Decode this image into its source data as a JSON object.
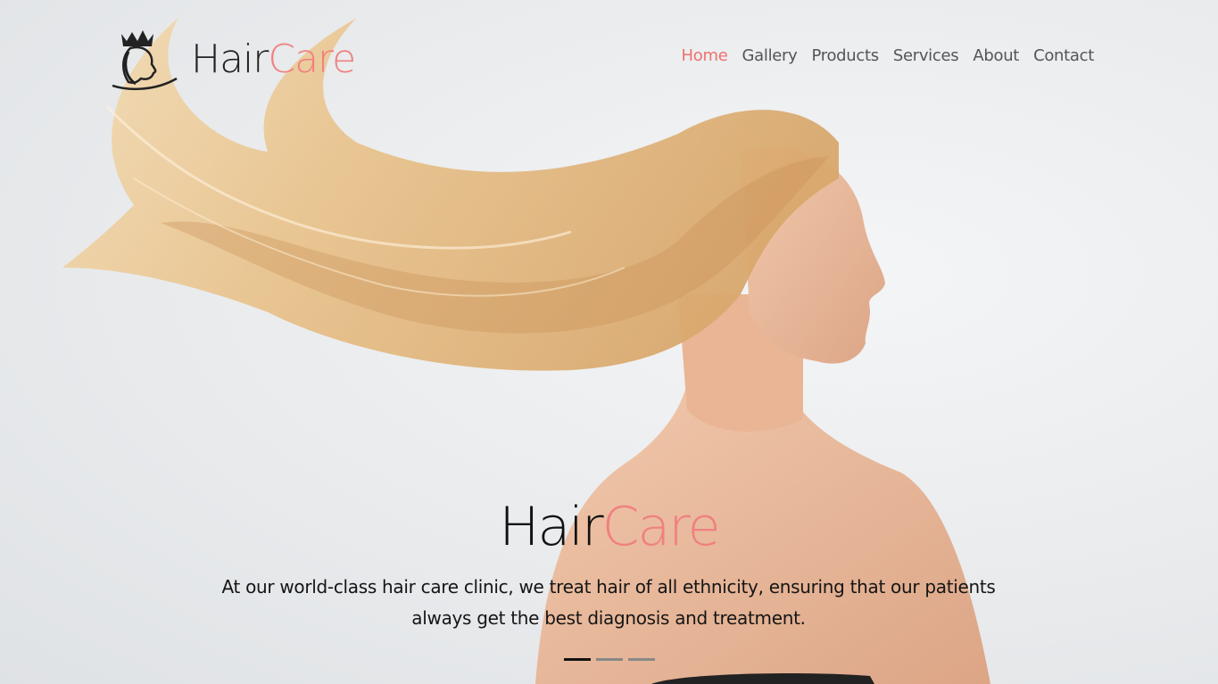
{
  "brand": {
    "part1": "Hair",
    "part2": "Care",
    "accent_color": "#f08080"
  },
  "nav": {
    "items": [
      {
        "label": "Home",
        "active": true
      },
      {
        "label": "Gallery",
        "active": false
      },
      {
        "label": "Products",
        "active": false
      },
      {
        "label": "Services",
        "active": false
      },
      {
        "label": "About",
        "active": false
      },
      {
        "label": "Contact",
        "active": false
      }
    ]
  },
  "hero": {
    "title_part1": "Hair",
    "title_part2": "Care",
    "tagline": "At our world-class hair care clinic, we treat hair of all ethnicity, ensuring that our patients always get the best diagnosis and treatment.",
    "slides": {
      "count": 3,
      "active_index": 0
    }
  },
  "icons": {
    "logo": "crowned-woman-profile-icon"
  }
}
